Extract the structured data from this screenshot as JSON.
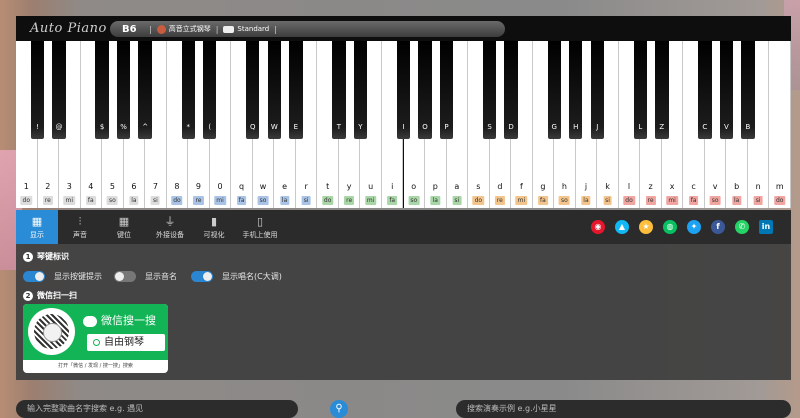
{
  "header": {
    "logo": "Auto Piano",
    "octave": "B6",
    "instrument": "高音立式钢琴",
    "mode": "Standard"
  },
  "piano": {
    "white_keys": [
      {
        "key": "1",
        "sol": "do",
        "color": "#dcdcdc"
      },
      {
        "key": "2",
        "sol": "re",
        "color": "#dcdcdc"
      },
      {
        "key": "3",
        "sol": "mi",
        "color": "#dcdcdc"
      },
      {
        "key": "4",
        "sol": "fa",
        "color": "#dcdcdc"
      },
      {
        "key": "5",
        "sol": "so",
        "color": "#dcdcdc"
      },
      {
        "key": "6",
        "sol": "la",
        "color": "#dcdcdc"
      },
      {
        "key": "7",
        "sol": "si",
        "color": "#dcdcdc"
      },
      {
        "key": "8",
        "sol": "do",
        "color": "#a8c3e6"
      },
      {
        "key": "9",
        "sol": "re",
        "color": "#a8c3e6"
      },
      {
        "key": "0",
        "sol": "mi",
        "color": "#a8c3e6"
      },
      {
        "key": "q",
        "sol": "fa",
        "color": "#a8c3e6"
      },
      {
        "key": "w",
        "sol": "so",
        "color": "#a8c3e6"
      },
      {
        "key": "e",
        "sol": "la",
        "color": "#a8c3e6"
      },
      {
        "key": "r",
        "sol": "si",
        "color": "#a8c3e6"
      },
      {
        "key": "t",
        "sol": "do",
        "color": "#a9d6a6"
      },
      {
        "key": "y",
        "sol": "re",
        "color": "#a9d6a6"
      },
      {
        "key": "u",
        "sol": "mi",
        "color": "#a9d6a6"
      },
      {
        "key": "i",
        "sol": "fa",
        "color": "#a9d6a6"
      },
      {
        "key": "o",
        "sol": "so",
        "color": "#a9d6a6"
      },
      {
        "key": "p",
        "sol": "la",
        "color": "#a9d6a6"
      },
      {
        "key": "a",
        "sol": "si",
        "color": "#a9d6a6"
      },
      {
        "key": "s",
        "sol": "do",
        "color": "#f3c58c"
      },
      {
        "key": "d",
        "sol": "re",
        "color": "#f3c58c"
      },
      {
        "key": "f",
        "sol": "mi",
        "color": "#f3c58c"
      },
      {
        "key": "g",
        "sol": "fa",
        "color": "#f3c58c"
      },
      {
        "key": "h",
        "sol": "so",
        "color": "#f3c58c"
      },
      {
        "key": "j",
        "sol": "la",
        "color": "#f3c58c"
      },
      {
        "key": "k",
        "sol": "si",
        "color": "#f3c58c"
      },
      {
        "key": "l",
        "sol": "do",
        "color": "#f0a5a0"
      },
      {
        "key": "z",
        "sol": "re",
        "color": "#f0a5a0"
      },
      {
        "key": "x",
        "sol": "mi",
        "color": "#f0a5a0"
      },
      {
        "key": "c",
        "sol": "fa",
        "color": "#f0a5a0"
      },
      {
        "key": "v",
        "sol": "so",
        "color": "#f0a5a0"
      },
      {
        "key": "b",
        "sol": "la",
        "color": "#f0a5a0"
      },
      {
        "key": "n",
        "sol": "si",
        "color": "#f0a5a0"
      },
      {
        "key": "m",
        "sol": "do",
        "color": "#f0a5a0"
      }
    ],
    "black_keys": [
      "!",
      "@",
      "$",
      "%",
      "^",
      "*",
      "(",
      "Q",
      "W",
      "E",
      "T",
      "Y",
      "I",
      "O",
      "P",
      "S",
      "D",
      "G",
      "H",
      "J",
      "L",
      "Z",
      "C",
      "V",
      "B"
    ]
  },
  "tabs": [
    {
      "label": "显示",
      "icon": "keyboard-icon",
      "active": true
    },
    {
      "label": "声音",
      "icon": "equalizer-icon"
    },
    {
      "label": "键位",
      "icon": "keyboard-icon"
    },
    {
      "label": "外接设备",
      "icon": "plug-icon"
    },
    {
      "label": "可视化",
      "icon": "bar-chart-icon"
    },
    {
      "label": "手机上使用",
      "icon": "mobile-icon"
    }
  ],
  "social": [
    {
      "name": "weibo-icon",
      "color": "#e6162d",
      "glyph": "◉"
    },
    {
      "name": "qq-icon",
      "color": "#12b7f5",
      "glyph": "▲"
    },
    {
      "name": "qzone-icon",
      "color": "#fdbe3d",
      "glyph": "★"
    },
    {
      "name": "wechat-icon",
      "color": "#07c160",
      "glyph": "◍"
    },
    {
      "name": "twitter-icon",
      "color": "#1da1f2",
      "glyph": "✦"
    },
    {
      "name": "facebook-icon",
      "color": "#3b5998",
      "glyph": "f"
    },
    {
      "name": "whatsapp-icon",
      "color": "#25d366",
      "glyph": "✆"
    },
    {
      "name": "linkedin-icon",
      "color": "#0077b5",
      "glyph": "in"
    }
  ],
  "display": {
    "section1_num": "1",
    "section1": "琴键标识",
    "toggles": [
      {
        "label": "显示按键提示",
        "on": true
      },
      {
        "label": "显示音名",
        "on": false
      },
      {
        "label": "显示唱名(C大调)",
        "on": true
      }
    ],
    "section2_num": "2",
    "section2": "微信扫一扫",
    "wechat_title": "微信搜一搜",
    "wechat_search": "自由钢琴",
    "wechat_footer": "打开「微信 / 发现 / 搜一搜」搜索"
  },
  "bottom": {
    "song_placeholder": "输入完整歌曲名字搜索  e.g. 遇见",
    "demo_placeholder": "搜索演奏示例  e.g.小星星"
  }
}
